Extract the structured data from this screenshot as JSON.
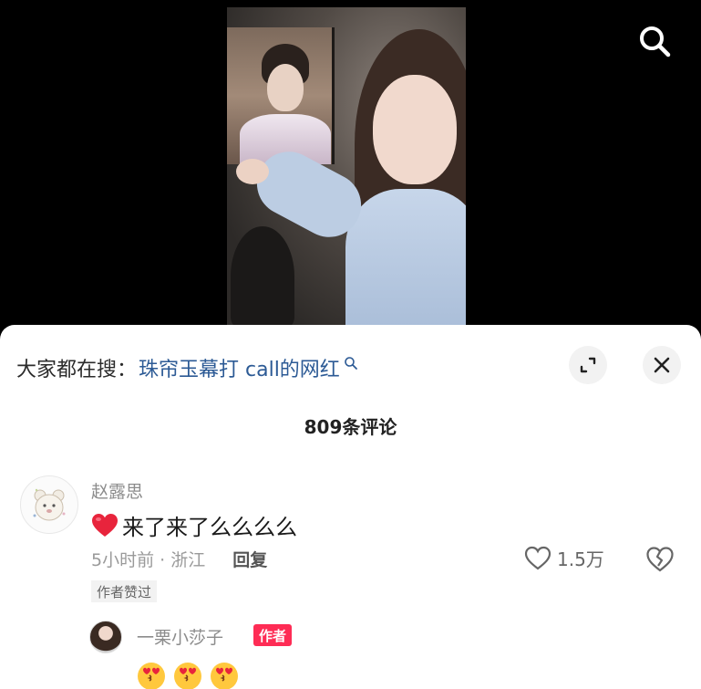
{
  "header": {
    "search_hint_prefix": "大家都在搜：",
    "search_hint_query": "珠帘玉幕打 call的网红",
    "icons": {
      "search": "search-icon",
      "expand": "expand-icon",
      "close": "close-icon"
    }
  },
  "comments": {
    "count_label": "809条评论",
    "items": [
      {
        "username": "赵露思",
        "text": "来了来了么么么么",
        "time_location": "5小时前 · 浙江",
        "reply_label": "回复",
        "likes": "1.5万",
        "badge": "作者赞过",
        "replies": [
          {
            "username": "一栗小莎子",
            "tag": "作者"
          }
        ]
      }
    ]
  },
  "colors": {
    "link": "#2c5a95",
    "author_tag": "#fe2c55",
    "heart": "#e8243c"
  }
}
